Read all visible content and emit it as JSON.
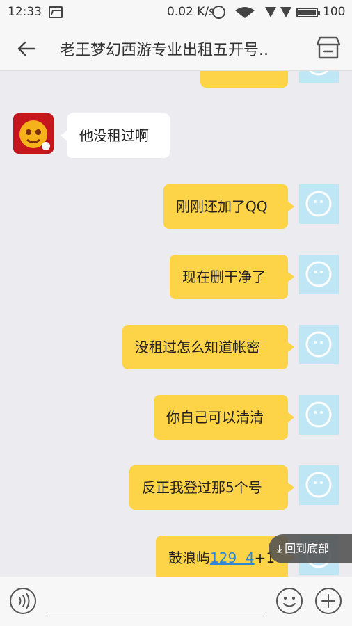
{
  "status_bar": {
    "time": "12:33",
    "speed": "0.02 K/s",
    "battery": "100",
    "icons": [
      "image-icon",
      "alarm-icon",
      "wifi-icon",
      "signal-icon",
      "signal-icon",
      "battery-icon"
    ]
  },
  "header": {
    "back_icon": "back-arrow-icon",
    "title": "老王梦幻西游专业出租五开号..",
    "store_icon": "store-icon"
  },
  "messages": [
    {
      "side": "self",
      "text": ""
    },
    {
      "side": "other",
      "text": "他没租过啊"
    },
    {
      "side": "self",
      "text": "刚刚还加了QQ"
    },
    {
      "side": "self",
      "text": "现在删干净了"
    },
    {
      "side": "self",
      "text": "没租过怎么知道帐密"
    },
    {
      "side": "self",
      "text": "你自己可以清清"
    },
    {
      "side": "self",
      "text": "反正我登过那5个号"
    },
    {
      "side": "self",
      "text_prefix": "鼓浪屿",
      "link": "129  4",
      "text_suffix": "+1"
    }
  ],
  "jump_to_bottom": {
    "label": "回到底部",
    "icon": "arrow-down-icon"
  },
  "input_bar": {
    "voice_icon": "voice-icon",
    "placeholder": "",
    "emoji_icon": "emoji-icon",
    "plus_icon": "plus-icon"
  },
  "colors": {
    "outgoing_bubble": "#fdd348",
    "incoming_bubble": "#ffffff",
    "chat_background": "#ebebf0",
    "self_avatar": "#bfe6f4",
    "link": "#2f86d6"
  }
}
